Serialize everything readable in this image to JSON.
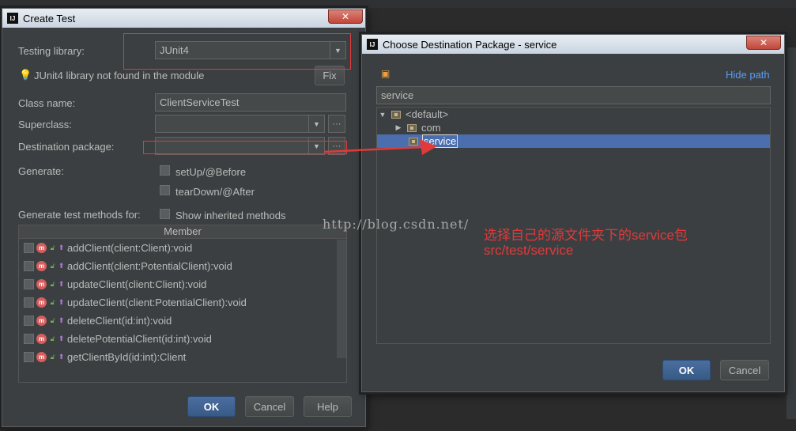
{
  "create_test": {
    "title": "Create Test",
    "close": "✕",
    "testing_library_label": "Testing library:",
    "testing_library_value": "JUnit4",
    "warning": "JUnit4 library not found in the module",
    "fix_label": "Fix",
    "class_name_label": "Class name:",
    "class_name_value": "ClientServiceTest",
    "superclass_label": "Superclass:",
    "superclass_value": "",
    "destination_label": "Destination package:",
    "destination_value": "",
    "generate_label": "Generate:",
    "setup_label": "setUp/@Before",
    "teardown_label": "tearDown/@After",
    "generate_methods_label": "Generate test methods for:",
    "show_inherited_label": "Show inherited methods",
    "member_header": "Member",
    "members": [
      "addClient(client:Client):void",
      "addClient(client:PotentialClient):void",
      "updateClient(client:Client):void",
      "updateClient(client:PotentialClient):void",
      "deleteClient(id:int):void",
      "deletePotentialClient(id:int):void",
      "getClientById(id:int):Client"
    ],
    "ok_label": "OK",
    "cancel_label": "Cancel",
    "help_label": "Help"
  },
  "choose_dest": {
    "title": "Choose Destination Package - service",
    "close": "✕",
    "hide_path": "Hide path",
    "path_value": "service",
    "tree": {
      "root": "<default>",
      "items": [
        "com",
        "service"
      ]
    },
    "ok_label": "OK",
    "cancel_label": "Cancel"
  },
  "annotation": {
    "watermark": "http://blog.csdn.net/",
    "line1": "选择自己的源文件夹下的service包",
    "line2": "src/test/service"
  },
  "colors": {
    "annotation_red": "#e03a3a",
    "selection_blue": "#4b6eaf",
    "link_blue": "#589df6"
  }
}
